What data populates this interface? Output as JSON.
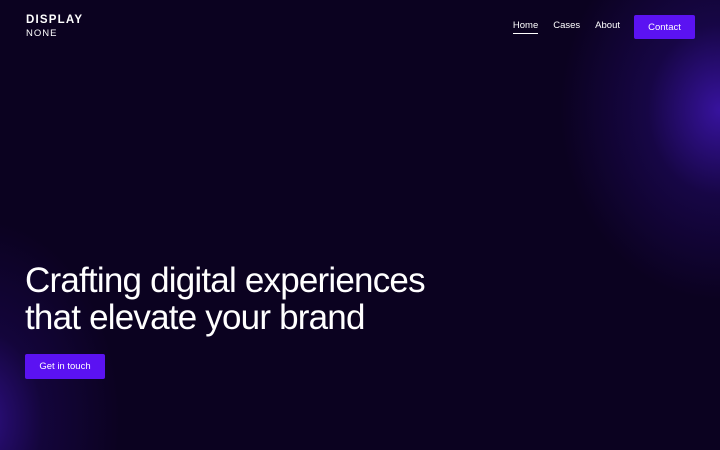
{
  "brand": {
    "logo_line1": "DISPLAY",
    "logo_line2": "NONE"
  },
  "nav": {
    "items": [
      {
        "label": "Home",
        "active": true
      },
      {
        "label": "Cases",
        "active": false
      },
      {
        "label": "About",
        "active": false
      }
    ],
    "contact_label": "Contact"
  },
  "hero": {
    "title_line1": "Crafting digital experiences",
    "title_line2": "that elevate your brand",
    "cta_label": "Get in touch"
  },
  "colors": {
    "background": "#0b0220",
    "accent": "#5b12f2",
    "glow": "#4618c8",
    "text": "#ffffff"
  }
}
